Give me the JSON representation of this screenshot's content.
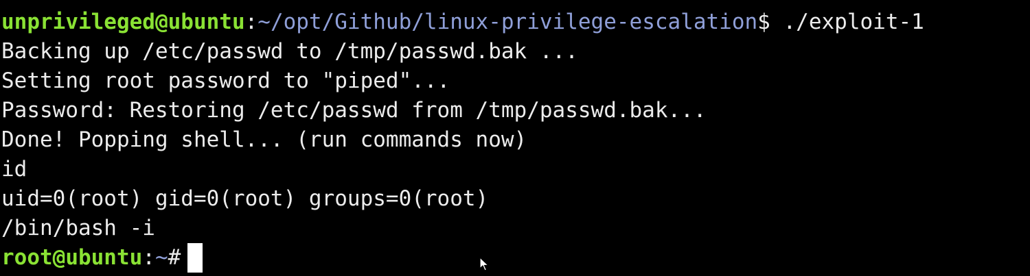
{
  "terminal": {
    "prompt1": {
      "user_host": "unprivileged@ubuntu",
      "separator": ":",
      "path": "~/opt/Github/linux-privilege-escalation",
      "symbol": "$",
      "command": "./exploit-1"
    },
    "output": [
      "Backing up /etc/passwd to /tmp/passwd.bak ...",
      "Setting root password to \"piped\"...",
      "Password: Restoring /etc/passwd from /tmp/passwd.bak...",
      "Done! Popping shell... (run commands now)",
      "id",
      "uid=0(root) gid=0(root) groups=0(root)",
      "/bin/bash -i"
    ],
    "prompt2": {
      "user_host": "root@ubuntu",
      "separator": ":",
      "path": "~",
      "symbol": "#"
    }
  },
  "colors": {
    "background": "#000000",
    "foreground": "#ececec",
    "prompt_user": "#8ae234",
    "prompt_path": "#8f9fd8",
    "cursor": "#ffffff"
  },
  "icons": {
    "mouse_pointer": "arrow-cursor-icon"
  }
}
